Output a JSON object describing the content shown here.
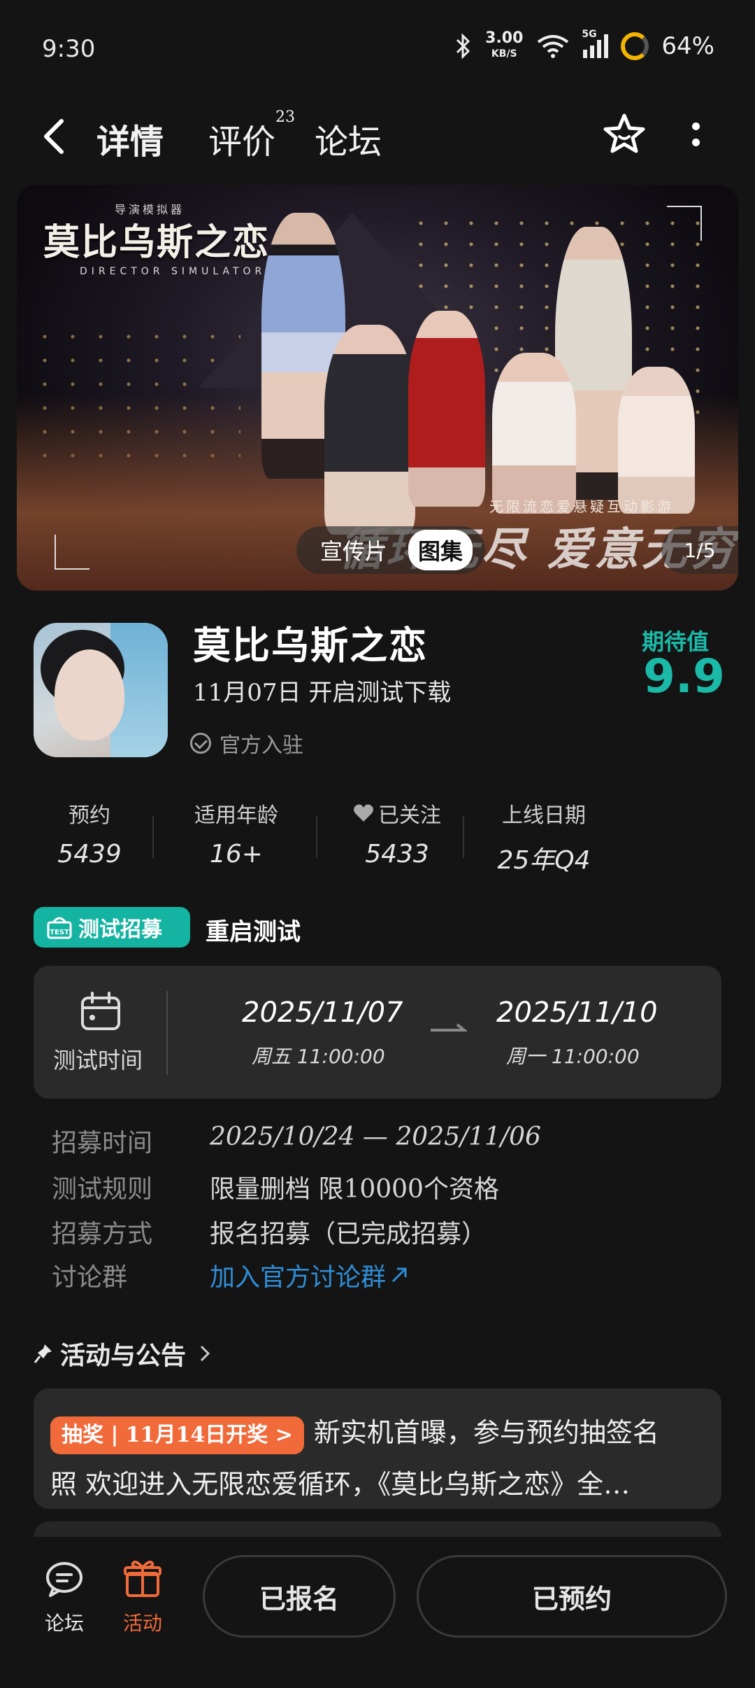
{
  "status_bar": {
    "time": "9:30",
    "net_speed": "3.00",
    "net_unit": "KB/S",
    "signal": "5G",
    "battery": "64%"
  },
  "nav": {
    "tabs": [
      {
        "label": "详情",
        "active": true
      },
      {
        "label": "评价",
        "badge": "23"
      },
      {
        "label": "论坛"
      }
    ]
  },
  "banner": {
    "logo_top": "导演模拟器",
    "logo_title": "莫比乌斯之恋",
    "logo_sub": "DIRECTOR SIMULATOR",
    "slogan_small": "无限流恋爱悬疑互动影游",
    "slogan": "循环无尽 爱意无穷",
    "tab_video": "宣传片",
    "tab_gallery": "图集",
    "counter": "1/5"
  },
  "game": {
    "title": "莫比乌斯之恋",
    "test_line": "11月07日 开启测试下载",
    "official": "官方入驻",
    "expect_label": "期待值",
    "expect_value": "9.9"
  },
  "stats": [
    {
      "label": "预约",
      "value": "5439"
    },
    {
      "label": "适用年龄",
      "value": "16+"
    },
    {
      "label": "已关注",
      "value": "5433"
    },
    {
      "label": "上线日期",
      "value": "25年Q4"
    }
  ],
  "recruit": {
    "tag": "测试招募",
    "tag_icon_text": "TEST",
    "title": "重启测试",
    "time_label": "测试时间",
    "start_date": "2025/11/07",
    "start_sub": "周五  11:00:00",
    "end_date": "2025/11/10",
    "end_sub": "周一  11:00:00",
    "rows": [
      {
        "label": "招募时间",
        "value": "2025/10/24 — 2025/11/06"
      },
      {
        "label": "测试规则",
        "value": "限量删档 限10000个资格"
      },
      {
        "label": "招募方式",
        "value": "报名招募（已完成招募）"
      },
      {
        "label": "讨论群",
        "value": "加入官方讨论群"
      }
    ]
  },
  "activity": {
    "heading": "活动与公告",
    "tag": "抽奖 | 11月14日开奖 >",
    "line1": "新实机首曝，参与预约抽签名",
    "line2": "照 欢迎进入无限恋爱循环，《莫比乌斯之恋》全…"
  },
  "bottom": {
    "forum": "论坛",
    "activity": "活动",
    "signed": "已报名",
    "reserved": "已预约"
  },
  "colors": {
    "accent": "#14b3a2",
    "orange": "#f06a3a",
    "link": "#2f8dd6",
    "background": "#141414",
    "card": "#2a2a2a"
  }
}
